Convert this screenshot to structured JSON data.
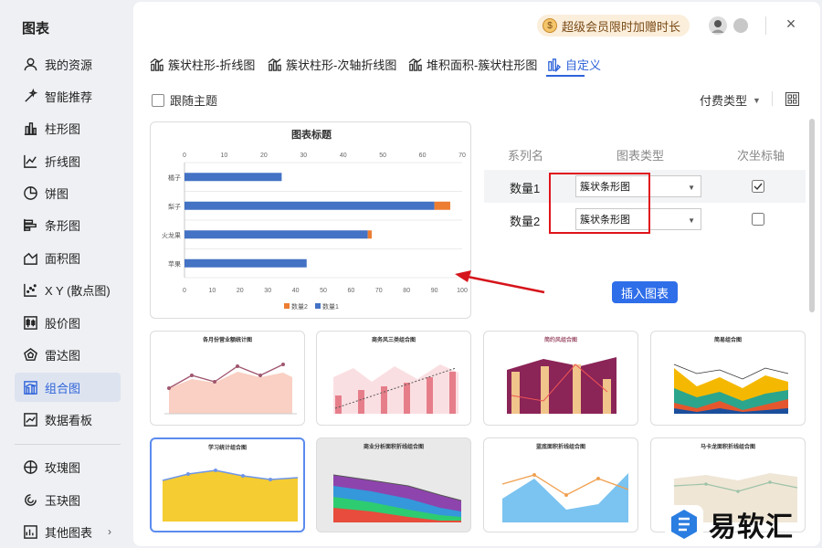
{
  "sidebar": {
    "title": "图表",
    "items": [
      {
        "label": "我的资源",
        "icon": "user-icon"
      },
      {
        "label": "智能推荐",
        "icon": "magic-icon"
      },
      {
        "label": "柱形图",
        "icon": "column-chart-icon"
      },
      {
        "label": "折线图",
        "icon": "line-chart-icon"
      },
      {
        "label": "饼图",
        "icon": "pie-chart-icon"
      },
      {
        "label": "条形图",
        "icon": "bar-chart-icon"
      },
      {
        "label": "面积图",
        "icon": "area-chart-icon"
      },
      {
        "label": "X Y (散点图)",
        "icon": "scatter-chart-icon"
      },
      {
        "label": "股价图",
        "icon": "stock-chart-icon"
      },
      {
        "label": "雷达图",
        "icon": "radar-chart-icon"
      },
      {
        "label": "组合图",
        "icon": "combo-chart-icon",
        "active": true
      },
      {
        "label": "数据看板",
        "icon": "dashboard-icon"
      },
      {
        "label": "玫瑰图",
        "icon": "rose-chart-icon"
      },
      {
        "label": "玉玦图",
        "icon": "ring-chart-icon"
      },
      {
        "label": "其他图表",
        "icon": "other-chart-icon"
      }
    ]
  },
  "header": {
    "vip_label": "超级会员限时加赠时长",
    "tabs": [
      {
        "label": "簇状柱形-折线图"
      },
      {
        "label": "簇状柱形-次轴折线图"
      },
      {
        "label": "堆积面积-簇状柱形图"
      },
      {
        "label": "自定义",
        "active": true
      }
    ]
  },
  "toolbar": {
    "follow_theme": "跟随主题",
    "pay_type": "付费类型"
  },
  "series_table": {
    "headers": [
      "系列名",
      "图表类型",
      "次坐标轴"
    ],
    "rows": [
      {
        "name": "数量1",
        "type": "簇状条形图",
        "secondary": true
      },
      {
        "name": "数量2",
        "type": "簇状条形图",
        "secondary": false
      }
    ],
    "insert_label": "插入图表"
  },
  "chart_data": {
    "type": "bar",
    "title": "图表标题",
    "categories": [
      "橘子",
      "梨子",
      "火龙果",
      "苹果"
    ],
    "series": [
      {
        "name": "数量1",
        "values": [
          35,
          90,
          66,
          44
        ],
        "color": "#4472c4",
        "axis": "bottom"
      },
      {
        "name": "数量2",
        "values": [
          0,
          4,
          1,
          0
        ],
        "color": "#ed7d31",
        "axis": "top"
      }
    ],
    "top_axis_ticks": [
      "0",
      "10",
      "20",
      "30",
      "40",
      "50",
      "60",
      "70"
    ],
    "bottom_axis_ticks": [
      "0",
      "10",
      "20",
      "30",
      "40",
      "50",
      "60",
      "70",
      "80",
      "90",
      "100"
    ],
    "xlim": [
      0,
      100
    ],
    "legend": [
      "数量2",
      "数量1"
    ],
    "legend_position": "bottom"
  },
  "templates": [
    {
      "title": "各月份营业额统计图"
    },
    {
      "title": "商务风三类组合图"
    },
    {
      "title": "简约风组合图"
    },
    {
      "title": "简易组合图"
    },
    {
      "title": "学习统计组合图"
    },
    {
      "title": "商业分析面积折线组合图"
    },
    {
      "title": "蓝底面积折线组合图"
    },
    {
      "title": "马卡龙面积折线组合图"
    }
  ],
  "watermark": {
    "text": "易软汇"
  },
  "colors": {
    "accent": "#2f63d9",
    "highlight_box": "#e0141b",
    "arrow": "#d6141b"
  }
}
